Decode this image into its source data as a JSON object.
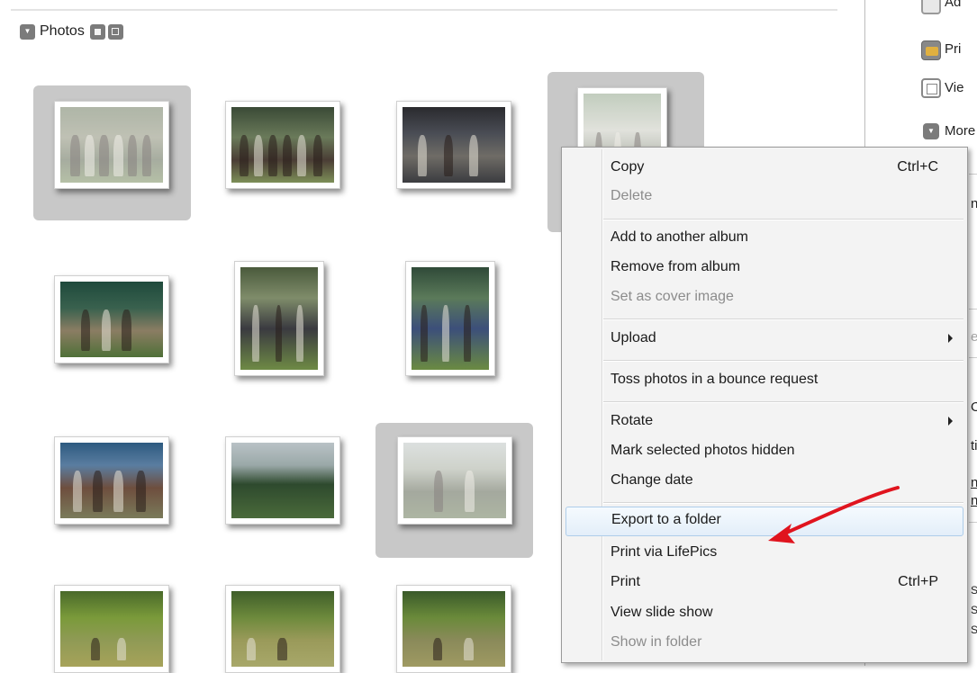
{
  "header": {
    "title": "Photos"
  },
  "menu": {
    "items": [
      {
        "id": "copy",
        "label": "Copy",
        "shortcut": "Ctrl+C",
        "disabled": false,
        "submenu": false
      },
      {
        "id": "delete",
        "label": "Delete",
        "shortcut": "",
        "disabled": true,
        "submenu": false
      },
      {
        "id": "add-to-album",
        "label": "Add to another album",
        "shortcut": "",
        "disabled": false,
        "submenu": false
      },
      {
        "id": "remove-from-album",
        "label": "Remove from album",
        "shortcut": "",
        "disabled": false,
        "submenu": false
      },
      {
        "id": "set-cover",
        "label": "Set as cover image",
        "shortcut": "",
        "disabled": true,
        "submenu": false
      },
      {
        "id": "upload",
        "label": "Upload",
        "shortcut": "",
        "disabled": false,
        "submenu": true
      },
      {
        "id": "toss",
        "label": "Toss photos in a bounce request",
        "shortcut": "",
        "disabled": false,
        "submenu": false
      },
      {
        "id": "rotate",
        "label": "Rotate",
        "shortcut": "",
        "disabled": false,
        "submenu": true
      },
      {
        "id": "mark-hidden",
        "label": "Mark selected photos hidden",
        "shortcut": "",
        "disabled": false,
        "submenu": false
      },
      {
        "id": "change-date",
        "label": "Change date",
        "shortcut": "",
        "disabled": false,
        "submenu": false
      },
      {
        "id": "export",
        "label": "Export to a folder",
        "shortcut": "",
        "disabled": false,
        "submenu": false,
        "highlighted": true
      },
      {
        "id": "print-lifepics",
        "label": "Print via LifePics",
        "shortcut": "",
        "disabled": false,
        "submenu": false
      },
      {
        "id": "print",
        "label": "Print",
        "shortcut": "Ctrl+P",
        "disabled": false,
        "submenu": false
      },
      {
        "id": "slideshow",
        "label": "View slide show",
        "shortcut": "",
        "disabled": false,
        "submenu": false
      },
      {
        "id": "show-in-folder",
        "label": "Show in folder",
        "shortcut": "",
        "disabled": true,
        "submenu": false
      }
    ]
  },
  "right_panel": {
    "items": [
      {
        "text": "Ad",
        "icon": "album-icon"
      },
      {
        "text": "Pri",
        "icon": "print-photos-icon"
      },
      {
        "text": "Vie",
        "icon": "slideshow-icon"
      },
      {
        "text": "More",
        "icon": "dropdown-icon"
      }
    ],
    "fragments": [
      "n",
      "e",
      "O",
      "ti",
      "n",
      "n",
      "S",
      "S",
      "S"
    ]
  },
  "colors": {
    "highlight_border": "#aecdea",
    "arrow": "#e0141e",
    "selection": "#c8c8c8"
  },
  "icons": {
    "header_dropdown": "dropdown-icon",
    "view_small": "grid-view-icon",
    "view_large": "single-view-icon",
    "submenu": "chevron-right-icon",
    "callout": "red-arrow-icon"
  }
}
